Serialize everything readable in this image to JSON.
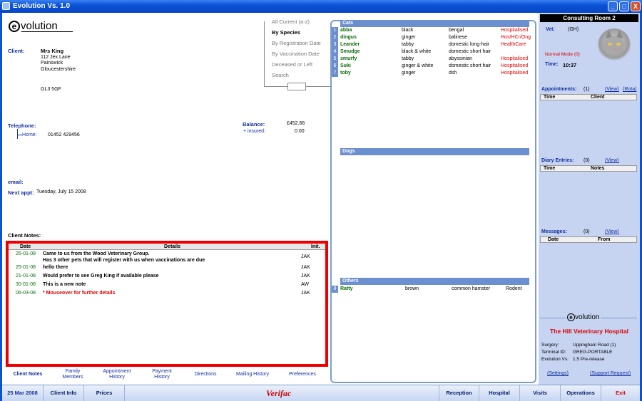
{
  "window": {
    "title": "Evolution Vs. 1.0",
    "min": "_",
    "max": "□",
    "close": "X"
  },
  "logo": {
    "text": "volution",
    "e": "e"
  },
  "client": {
    "label": "Client:",
    "name": "Mrs  King",
    "address": [
      "112 Jex Lane",
      "Painswick",
      "Gloucestershire"
    ],
    "postcode": "GL3 5GF",
    "telephone_label": "Telephone:",
    "home_label": "Home:",
    "home_number": "01452 429456",
    "email_label": "email:",
    "next_appt_label": "Next appt:",
    "next_appt": "Tuesday, July 15 2008",
    "notes_label": "Client Notes:"
  },
  "balance": {
    "label": "Balance:",
    "value": "£452.66",
    "insured_label": "+ insured:",
    "insured_value": "0.00"
  },
  "filters": [
    "All Current (a-z)",
    "By Species",
    "By Registration Date",
    "By Vaccination Date",
    "Deceased or Left",
    "Search"
  ],
  "filters_active_index": 1,
  "species": {
    "cats_label": "Cats",
    "cats": [
      {
        "n": "1",
        "name": "abba",
        "colour": "black",
        "breed": "bengal",
        "status": "Hospitalised"
      },
      {
        "n": "2",
        "name": "dingus",
        "colour": "ginger",
        "breed": "balinese",
        "status": "Hos/HCr/Ong"
      },
      {
        "n": "3",
        "name": "Leander",
        "colour": "tabby",
        "breed": "domestic long-hair",
        "status": "HealthCare"
      },
      {
        "n": "4",
        "name": "Smudge",
        "colour": "black & white",
        "breed": "domestic short hair",
        "status": ""
      },
      {
        "n": "5",
        "name": "smurfy",
        "colour": "tabby",
        "breed": "abyssinian",
        "status": "Hospitalised"
      },
      {
        "n": "6",
        "name": "Suki",
        "colour": "ginger & white",
        "breed": "domestic short hair",
        "status": "Hospitalised"
      },
      {
        "n": "7",
        "name": "toby",
        "colour": "ginger",
        "breed": "dsh",
        "status": "Hospitalised"
      }
    ],
    "dogs_label": "Dogs",
    "others_label": "Others",
    "others": [
      {
        "n": "8",
        "name": "Ratty",
        "colour": "brown",
        "breed": "common hamster",
        "status": "Rodent"
      }
    ]
  },
  "notes": {
    "headers": {
      "date": "Date",
      "details": "Details",
      "init": "Init."
    },
    "rows": [
      {
        "date": "25-01-08",
        "text": "Came to us from the Wood Veterinary Group.",
        "text2": "Has 3 other pets that will register with us when vaccinations are due",
        "init": "JAK"
      },
      {
        "date": "25-01-08",
        "text": "hello there",
        "init": "JAK"
      },
      {
        "date": "21-01-08",
        "text": "Would prefer to see Greg King if available please",
        "init": "JAK"
      },
      {
        "date": "30-01-08",
        "text": "This is a new note",
        "init": "AW"
      },
      {
        "date": "06-03-08",
        "text": "* Mouseover for further details",
        "init": "JAK"
      }
    ]
  },
  "subtabs": [
    {
      "label": "Client Notes"
    },
    {
      "label": "Family",
      "label2": "Members"
    },
    {
      "label": "Appointment",
      "label2": "History"
    },
    {
      "label": "Payment",
      "label2": "History"
    },
    {
      "label": "Directions"
    },
    {
      "label": "Mailing History"
    },
    {
      "label": "Preferences"
    }
  ],
  "right": {
    "room": "Consulting Room 2",
    "vet_label": "Vet:",
    "vet_value": "(GH)",
    "mode": "Normal Mode (0)",
    "time_label": "Time:",
    "time_value": "10:37",
    "appointments_label": "Appointments:",
    "appointments_count": "(1)",
    "view": "(View)",
    "rota": "(Rota)",
    "appt_cols": [
      "Time",
      "Client"
    ],
    "diary_label": "Diary Entries:",
    "diary_count": "(0)",
    "diary_cols": [
      "Time",
      "Notes"
    ],
    "messages_label": "Messages:",
    "messages_count": "(0)",
    "msg_cols": [
      "Date",
      "From"
    ],
    "hospital_name": "The Hill Veterinary Hospital",
    "surgery_label": "Surgery:",
    "surgery_value": "Uppingham Road (1)",
    "terminal_label": "Terminal ID:",
    "terminal_value": "GREG-PORTABLE",
    "evo_label": "Evolution Vs:",
    "evo_value": "1.5 Pre-release",
    "settings": "(Settings)",
    "support": "(Support Request)"
  },
  "bottom": {
    "date": "25 Mar 2008",
    "client_info": "Client Info",
    "prices": "Prices",
    "brand": "Verifac",
    "reception": "Reception",
    "hospital": "Hospital",
    "visits": "Visits",
    "operations": "Operations",
    "exit": "Exit"
  }
}
